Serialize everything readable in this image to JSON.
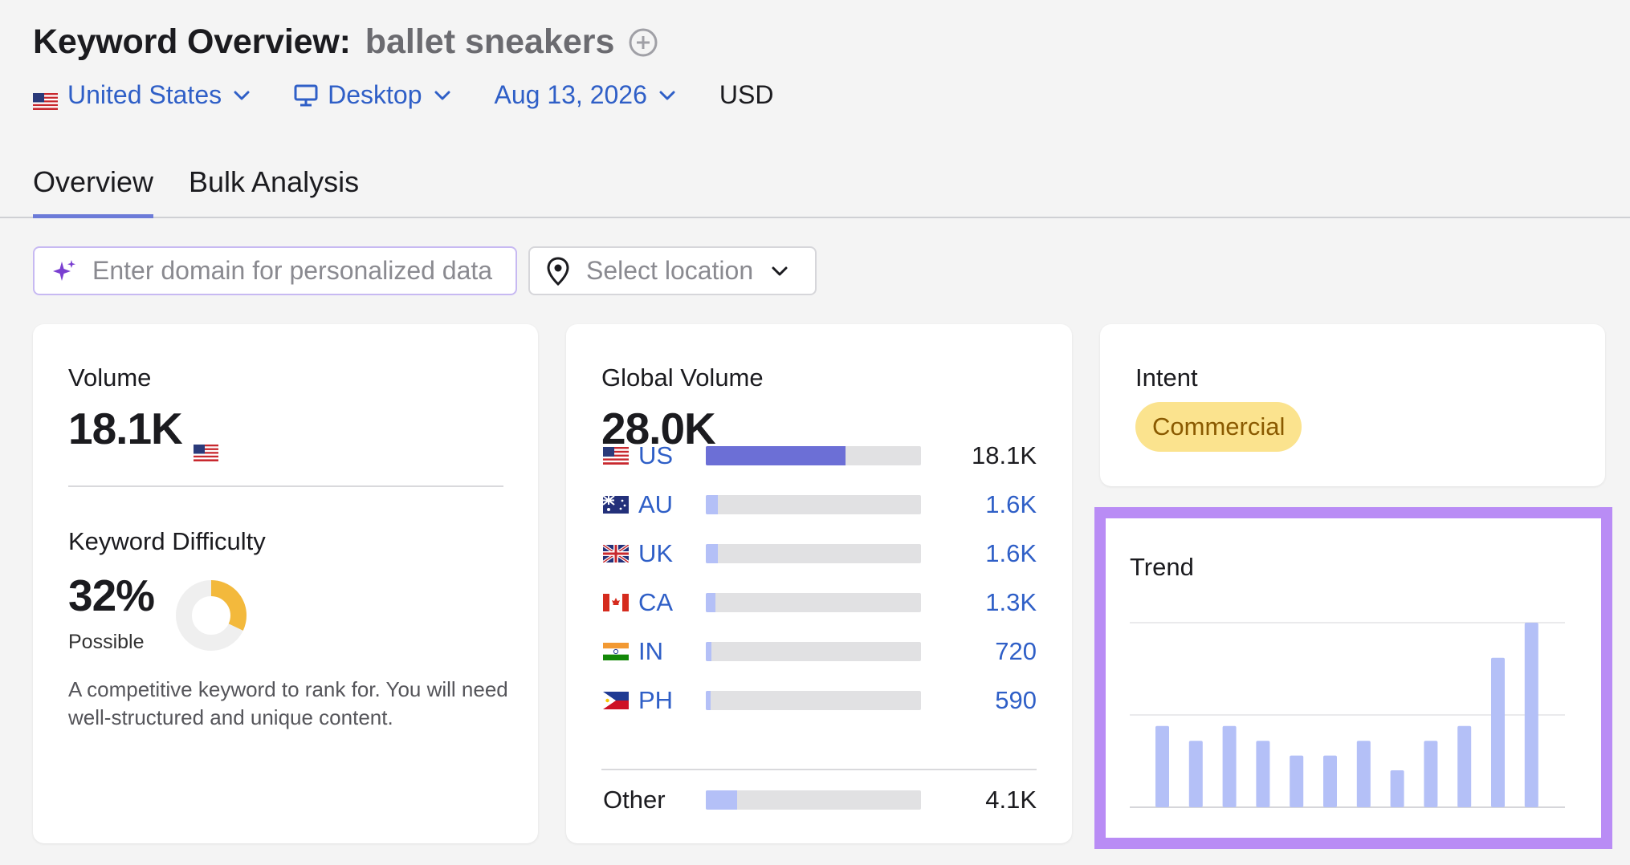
{
  "header": {
    "title": "Keyword Overview:",
    "keyword": "ballet sneakers"
  },
  "filters": {
    "country": "United States",
    "device": "Desktop",
    "date": "Aug 13, 2026",
    "currency": "USD"
  },
  "tabs": [
    {
      "label": "Overview",
      "active": true
    },
    {
      "label": "Bulk Analysis",
      "active": false
    }
  ],
  "domain_input": {
    "placeholder": "Enter domain for personalized data",
    "value": ""
  },
  "location_select": {
    "placeholder": "Select location"
  },
  "volume_card": {
    "label": "Volume",
    "value": "18.1K",
    "kd_label": "Keyword Difficulty",
    "kd_value": "32%",
    "kd_percent": 32,
    "kd_level": "Possible",
    "kd_description": "A competitive keyword to rank for. You will need well-structured and unique content.",
    "kd_color": "#f3b93c"
  },
  "global_volume_card": {
    "label": "Global Volume",
    "value": "28.0K",
    "countries": [
      {
        "code": "US",
        "value": "18.1K",
        "share": 0.65,
        "flag": "flag-us"
      },
      {
        "code": "AU",
        "value": "1.6K",
        "share": 0.057,
        "flag": "flag-au"
      },
      {
        "code": "UK",
        "value": "1.6K",
        "share": 0.057,
        "flag": "flag-uk"
      },
      {
        "code": "CA",
        "value": "1.3K",
        "share": 0.046,
        "flag": "flag-ca"
      },
      {
        "code": "IN",
        "value": "720",
        "share": 0.026,
        "flag": "flag-in"
      },
      {
        "code": "PH",
        "value": "590",
        "share": 0.021,
        "flag": "flag-ph"
      }
    ],
    "other": {
      "label": "Other",
      "value": "4.1K",
      "share": 0.146
    },
    "bar_color_primary": "#6c6fd6",
    "bar_color_secondary": "#b4c0f7"
  },
  "intent_card": {
    "label": "Intent",
    "badge": "Commercial",
    "badge_color": "#fbe38e"
  },
  "trend_card": {
    "label": "Trend",
    "highlight_color": "#b98cf5",
    "bar_color": "#b4c0f7",
    "chart_data": {
      "type": "bar",
      "series": [
        {
          "values": [
            0.44,
            0.36,
            0.44,
            0.36,
            0.28,
            0.28,
            0.36,
            0.2,
            0.36,
            0.44,
            0.81,
            1.0
          ]
        }
      ],
      "ylim": [
        0,
        1
      ],
      "grid": true
    }
  }
}
